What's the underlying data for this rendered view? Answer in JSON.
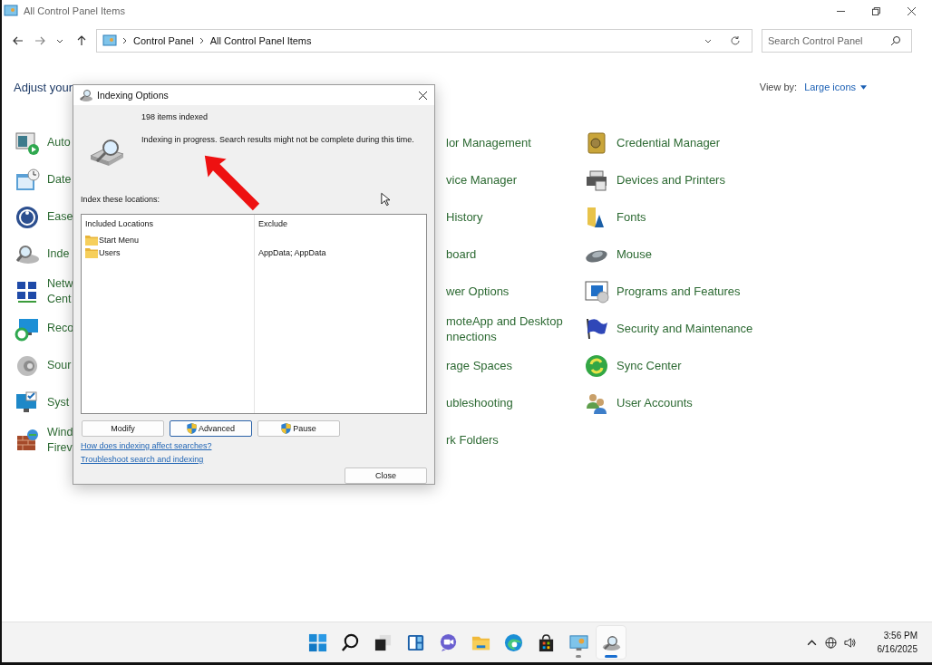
{
  "window": {
    "title": "All Control Panel Items"
  },
  "address_bar": {
    "breadcrumb": [
      "Control Panel",
      "All Control Panel Items"
    ]
  },
  "search": {
    "placeholder": "Search Control Panel"
  },
  "heading": "Adjust your",
  "view_by": {
    "label": "View by:",
    "value": "Large icons"
  },
  "left_items": [
    {
      "lines": [
        "Auto"
      ]
    },
    {
      "lines": [
        "Date"
      ]
    },
    {
      "lines": [
        "Ease"
      ]
    },
    {
      "lines": [
        "Inde"
      ]
    },
    {
      "lines": [
        "Netw",
        "Cent"
      ]
    },
    {
      "lines": [
        "Reco"
      ]
    },
    {
      "lines": [
        "Sour"
      ]
    },
    {
      "lines": [
        "Syst"
      ]
    },
    {
      "lines": [
        "Wind",
        "Firev"
      ]
    }
  ],
  "middle_items": [
    {
      "lines": [
        "lor Management"
      ]
    },
    {
      "lines": [
        "vice Manager"
      ]
    },
    {
      "lines": [
        "History"
      ]
    },
    {
      "lines": [
        "board"
      ]
    },
    {
      "lines": [
        "wer Options"
      ]
    },
    {
      "lines": [
        "moteApp and Desktop",
        "nnections"
      ]
    },
    {
      "lines": [
        "rage Spaces"
      ]
    },
    {
      "lines": [
        "ubleshooting"
      ]
    },
    {
      "lines": [
        "rk Folders"
      ]
    }
  ],
  "right_items": [
    {
      "lines": [
        "Credential Manager"
      ]
    },
    {
      "lines": [
        "Devices and Printers"
      ]
    },
    {
      "lines": [
        "Fonts"
      ]
    },
    {
      "lines": [
        "Mouse"
      ]
    },
    {
      "lines": [
        "Programs and Features"
      ]
    },
    {
      "lines": [
        "Security and Maintenance"
      ]
    },
    {
      "lines": [
        "Sync Center"
      ]
    },
    {
      "lines": [
        "User Accounts"
      ]
    }
  ],
  "dialog": {
    "title": "Indexing Options",
    "count": "198 items indexed",
    "status": "Indexing in progress. Search results might not be complete during this time.",
    "list_label": "Index these locations:",
    "columns": [
      "Included Locations",
      "Exclude"
    ],
    "rows": [
      {
        "location": "Start Menu"
      },
      {
        "location": "Users",
        "exclude": "AppData; AppData"
      }
    ],
    "buttons": [
      {
        "label": "Modify",
        "shield": false,
        "focused": false
      },
      {
        "label": "Advanced",
        "shield": true,
        "focused": true
      },
      {
        "label": "Pause",
        "shield": true,
        "focused": false
      }
    ],
    "links": [
      "How does indexing affect searches?",
      "Troubleshoot search and indexing"
    ],
    "close_button": "Close"
  },
  "taskbar": {
    "apps": [
      {
        "open": false,
        "selected": false
      },
      {
        "open": false,
        "selected": false
      },
      {
        "open": false,
        "selected": false
      },
      {
        "open": false,
        "selected": false
      },
      {
        "open": false,
        "selected": false
      },
      {
        "open": false,
        "selected": false
      },
      {
        "open": false,
        "selected": false
      },
      {
        "open": false,
        "selected": false
      },
      {
        "open": true,
        "selected": false
      },
      {
        "open": true,
        "selected": true
      }
    ],
    "time": "3:56 PM",
    "date": "6/16/2025"
  }
}
